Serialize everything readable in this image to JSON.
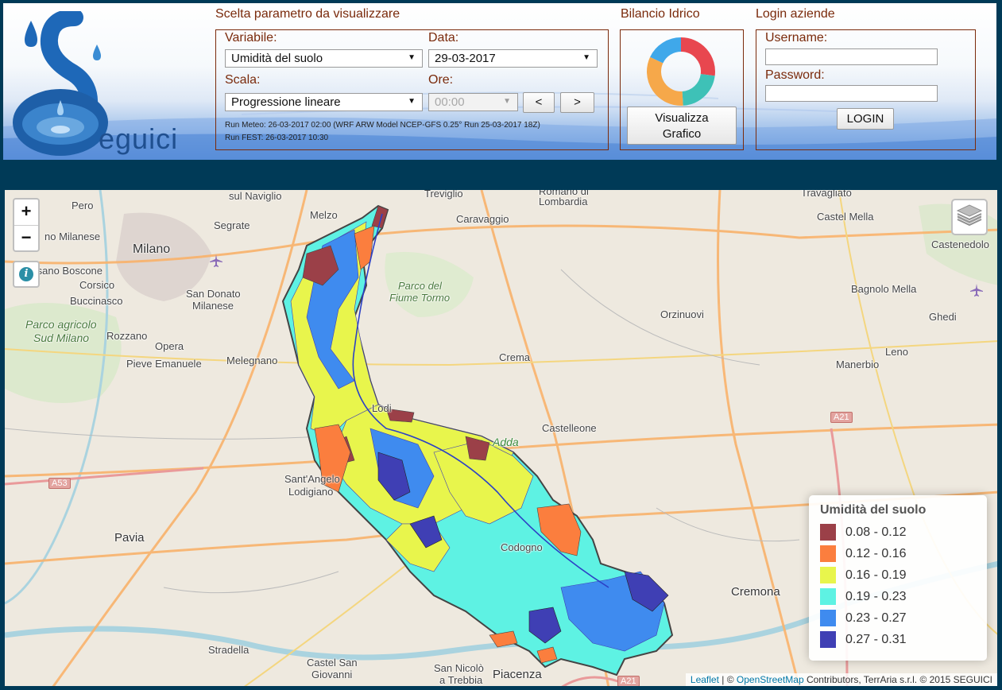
{
  "logo": {
    "text": "eguici"
  },
  "params": {
    "title": "Scelta parametro da visualizzare",
    "variable_label": "Variabile:",
    "variable_value": "Umidità del suolo",
    "date_label": "Data:",
    "date_value": "29-03-2017",
    "scale_label": "Scala:",
    "scale_value": "Progressione lineare",
    "hours_label": "Ore:",
    "hours_value": "00:00",
    "prev_label": "<",
    "next_label": ">",
    "run_meteo": "Run Meteo: 26-03-2017 02:00 (WRF ARW Model NCEP-GFS 0.25° Run 25-03-2017 18Z)",
    "run_fest": "Run FEST: 26-03-2017 10:30"
  },
  "bilancio": {
    "title": "Bilancio Idrico",
    "button_line1": "Visualizza",
    "button_line2": "Grafico",
    "donut_colors": [
      "#e8474f",
      "#3ec1b7",
      "#f6a84a",
      "#3fa8ea"
    ]
  },
  "login": {
    "title": "Login aziende",
    "username_label": "Username:",
    "password_label": "Password:",
    "button": "LOGIN"
  },
  "map": {
    "zoom_in": "+",
    "zoom_out": "−",
    "info": "i",
    "places": [
      {
        "t": "sul Naviglio"
      },
      {
        "t": "Treviglio"
      },
      {
        "t": "Romano di"
      },
      {
        "t": "Lombardia"
      },
      {
        "t": "Travagliato"
      },
      {
        "t": "Pero"
      },
      {
        "t": "Melzo"
      },
      {
        "t": "Caravaggio"
      },
      {
        "t": "Castel Mella"
      },
      {
        "t": "no Milanese"
      },
      {
        "t": "Segrate"
      },
      {
        "t": "Castenedolo"
      },
      {
        "t": "Milano"
      },
      {
        "t": "Cesano Boscone"
      },
      {
        "t": "Corsico"
      },
      {
        "t": "Buccinasco"
      },
      {
        "t": "San Donato"
      },
      {
        "t": "Milanese"
      },
      {
        "t": "Parco del"
      },
      {
        "t": "Fiume Tormo"
      },
      {
        "t": "Bagnolo Mella"
      },
      {
        "t": "Parco agricolo"
      },
      {
        "t": "Sud Milano"
      },
      {
        "t": "Rozzano"
      },
      {
        "t": "Opera"
      },
      {
        "t": "Pieve Emanuele"
      },
      {
        "t": "Orzinuovi"
      },
      {
        "t": "Ghedi"
      },
      {
        "t": "Melegnano"
      },
      {
        "t": "Crema"
      },
      {
        "t": "Leno"
      },
      {
        "t": "Manerbio"
      },
      {
        "t": "Lodi"
      },
      {
        "t": "Castelleone"
      },
      {
        "t": "Adda"
      },
      {
        "t": "Sant'Angelo"
      },
      {
        "t": "Lodigiano"
      },
      {
        "t": "Pavia"
      },
      {
        "t": "Codogno"
      },
      {
        "t": "Cremona"
      },
      {
        "t": "Stradella"
      },
      {
        "t": "Castel San"
      },
      {
        "t": "Giovanni"
      },
      {
        "t": "San Nicolò"
      },
      {
        "t": "a Trebbia"
      },
      {
        "t": "Piacenza"
      }
    ],
    "shields": [
      "A53",
      "A21",
      "A21"
    ],
    "attribution": {
      "leaflet": "Leaflet",
      "osm": "OpenStreetMap",
      "rest": " Contributors, TerrAria s.r.l. © 2015 SEGUICI",
      "sep": " | © "
    }
  },
  "legend": {
    "title": "Umidità del suolo",
    "items": [
      {
        "label": "0.08 - 0.12",
        "color": "#9b4048"
      },
      {
        "label": "0.12 - 0.16",
        "color": "#fb7e3e"
      },
      {
        "label": "0.16 - 0.19",
        "color": "#e8f54c"
      },
      {
        "label": "0.19 - 0.23",
        "color": "#5ef2e3"
      },
      {
        "label": "0.23 - 0.27",
        "color": "#3f8bef"
      },
      {
        "label": "0.27 - 0.31",
        "color": "#3f3fb4"
      }
    ]
  }
}
